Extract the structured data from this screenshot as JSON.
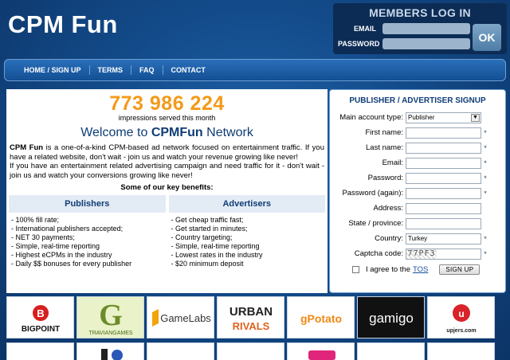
{
  "site": {
    "title": "CPM Fun"
  },
  "login": {
    "title": "MEMBERS LOG IN",
    "email_label": "EMAIL",
    "password_label": "PASSWORD",
    "ok_label": "OK"
  },
  "nav": {
    "items": [
      "HOME / SIGN UP",
      "TERMS",
      "FAQ",
      "CONTACT"
    ]
  },
  "stats": {
    "impressions": "773 986 224",
    "caption": "impressions served this month"
  },
  "welcome": {
    "prefix": "Welcome to ",
    "brand": "CPMFun",
    "suffix": " Network"
  },
  "intro": {
    "brand": "CPM Fun",
    "p1": " is a one-of-a-kind CPM-based ad network focused on entertainment traffic. If you have a related website, don't wait - join us and watch your revenue growing like never!",
    "p2": "If you have an entertainment related advertising campaign and need traffic for it - don't wait - join us and watch your conversions growing like never!"
  },
  "benefits": {
    "title": "Some of our key benefits:",
    "publishers": {
      "heading": "Publishers",
      "items": [
        "100% fill rate;",
        "International publishers accepted;",
        "NET 30 payments;",
        "Simple, real-time reporting",
        "Highest eCPMs in the industry",
        "Daily $$ bonuses for every publisher"
      ]
    },
    "advertisers": {
      "heading": "Advertisers",
      "items": [
        "Get cheap traffic fast;",
        "Get started in minutes;",
        "Country targeting;",
        "Simple, real-time reporting",
        "Lowest rates in the industry",
        "$20 minimum deposit"
      ]
    }
  },
  "signup": {
    "title": "PUBLISHER / ADVERTISER SIGNUP",
    "account_type_label": "Main account type:",
    "account_type_value": "Publisher",
    "fields": [
      "First name:",
      "Last name:",
      "Email:",
      "Password:",
      "Password (again):",
      "Address:",
      "State / province:"
    ],
    "country_label": "Country:",
    "country_value": "Turkey",
    "captcha_label": "Captcha code:",
    "captcha_value": "77PF3",
    "agree_text": "I agree to the",
    "tos_label": "TOS",
    "button_label": "SIGN UP",
    "required_mark": "*"
  },
  "partners": {
    "bigpoint": "BIGPOINT",
    "travian": "TRAVIANGAMES",
    "gamelabs": "GameLabs",
    "urban_top": "URBAN",
    "urban_bottom": "RIVALS",
    "gpotato": "gPotato",
    "gamigo": "gamigo",
    "upjers": "upjers.com"
  },
  "colors": {
    "accent": "#f39a1a",
    "brand_blue": "#0f3d75"
  }
}
